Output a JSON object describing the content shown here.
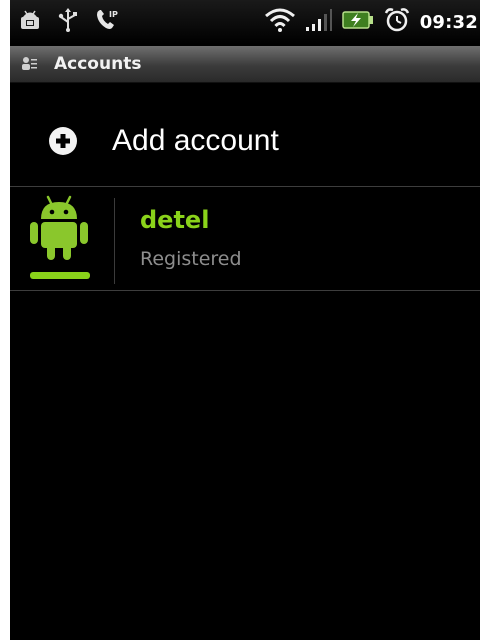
{
  "statusbar": {
    "time": "09:32",
    "left_icons": [
      "android-debug-icon",
      "usb-icon",
      "sip-call-icon"
    ],
    "right_icons": [
      "wifi-icon",
      "signal-icon",
      "battery-charging-icon",
      "alarm-icon"
    ]
  },
  "titlebar": {
    "title": "Accounts",
    "icon": "accounts-icon"
  },
  "add_account": {
    "label": "Add account",
    "icon": "plus-circle-icon"
  },
  "accounts": [
    {
      "name": "detel",
      "status": "Registered",
      "icon": "android-icon",
      "indicator_color": "#8ad21a"
    }
  ],
  "colors": {
    "accent": "#8ad21a",
    "background": "#000000",
    "secondary_text": "#8d8d8d"
  }
}
